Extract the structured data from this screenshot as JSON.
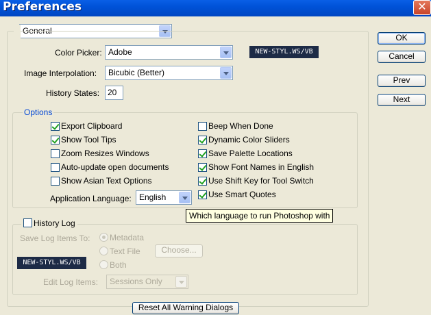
{
  "window": {
    "title": "Preferences"
  },
  "section_select": {
    "value": "General"
  },
  "color_picker": {
    "label": "Color Picker:",
    "value": "Adobe"
  },
  "interpolation": {
    "label": "Image Interpolation:",
    "value": "Bicubic (Better)"
  },
  "history_states": {
    "label": "History States:",
    "value": "20"
  },
  "watermark": "NEW-STYL.WS/VB",
  "buttons": {
    "ok": "OK",
    "cancel": "Cancel",
    "prev": "Prev",
    "next": "Next",
    "reset": "Reset All Warning Dialogs"
  },
  "options": {
    "legend": "Options",
    "left": [
      {
        "label": "Export Clipboard",
        "checked": true
      },
      {
        "label": "Show Tool Tips",
        "checked": true
      },
      {
        "label": "Zoom Resizes Windows",
        "checked": false
      },
      {
        "label": "Auto-update open documents",
        "checked": false
      },
      {
        "label": "Show Asian Text Options",
        "checked": false
      }
    ],
    "right": [
      {
        "label": "Beep When Done",
        "checked": false
      },
      {
        "label": "Dynamic Color Sliders",
        "checked": true
      },
      {
        "label": "Save Palette Locations",
        "checked": true
      },
      {
        "label": "Show Font Names in English",
        "checked": true
      },
      {
        "label": "Use Shift Key for Tool Switch",
        "checked": true
      },
      {
        "label": "Use Smart Quotes",
        "checked": true
      }
    ],
    "app_language_label": "Application Language:",
    "app_language_value": "English"
  },
  "tooltip": "Which language to run Photoshop with",
  "history_log": {
    "legend": "History Log",
    "checked": false,
    "save_label": "Save Log Items To:",
    "radios": [
      {
        "label": "Metadata",
        "checked": true
      },
      {
        "label": "Text File",
        "checked": false
      },
      {
        "label": "Both",
        "checked": false
      }
    ],
    "choose": "Choose...",
    "edit_label": "Edit Log Items:",
    "edit_value": "Sessions Only"
  }
}
